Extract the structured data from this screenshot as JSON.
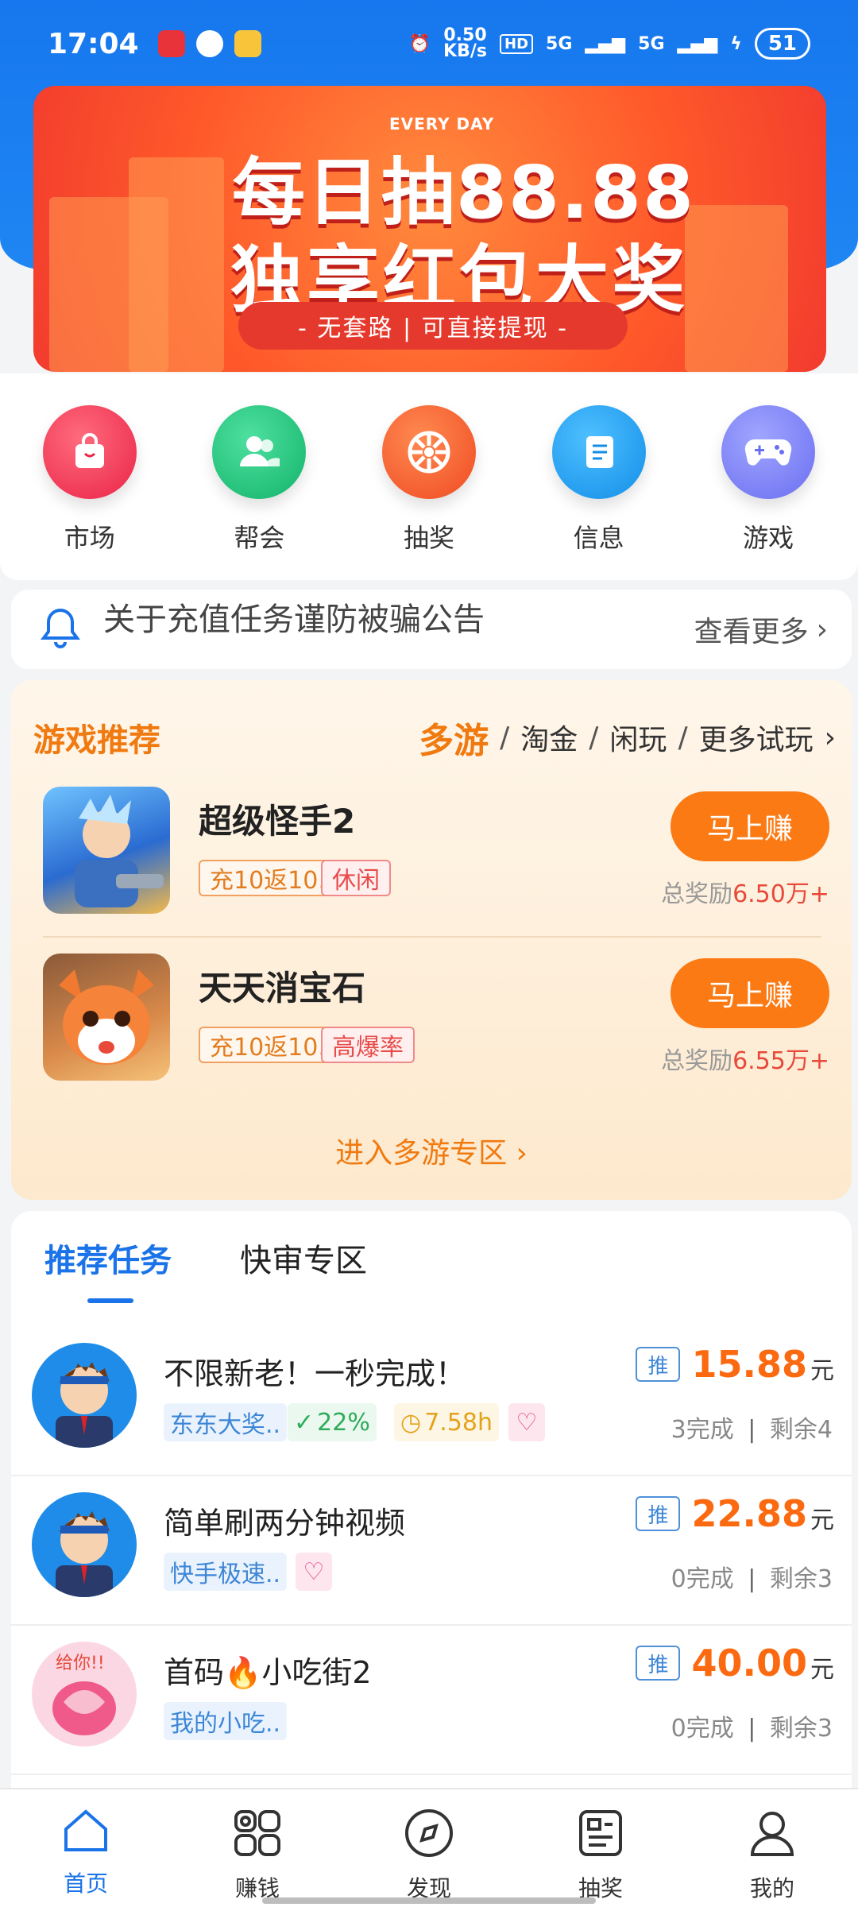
{
  "status_bar": {
    "time": "17:04",
    "net_speed": "0.50\nKB/s",
    "signal1": "5G",
    "signal2": "5G",
    "battery": "51"
  },
  "banner": {
    "tagline": "EVERY DAY",
    "line1": "每日抽88.88",
    "line2": "独享红包大奖",
    "pill": "- 无套路 | 可直接提现 -"
  },
  "quick_nav": [
    {
      "label": "市场",
      "icon": "bag-icon",
      "color": "#f23a55"
    },
    {
      "label": "帮会",
      "icon": "group-icon",
      "color": "#22c47e"
    },
    {
      "label": "抽奖",
      "icon": "wheel-icon",
      "color": "#f35a2c"
    },
    {
      "label": "信息",
      "icon": "document-icon",
      "color": "#1e9df3"
    },
    {
      "label": "游戏",
      "icon": "gamepad-icon",
      "color": "#7a7df5"
    }
  ],
  "notice": {
    "title": "关于充值任务谨防被骗公告",
    "more": "查看更多"
  },
  "games": {
    "title": "游戏推荐",
    "tabs": [
      "多游",
      "淘金",
      "闲玩",
      "更多试玩"
    ],
    "items": [
      {
        "name": "超级怪手2",
        "tag1": "充10返10.7元",
        "tag2": "休闲",
        "button": "马上赚",
        "reward_label": "总奖励",
        "reward_value": "6.50万+"
      },
      {
        "name": "天天消宝石",
        "tag1": "充10返10.7元",
        "tag2": "高爆率",
        "button": "马上赚",
        "reward_label": "总奖励",
        "reward_value": "6.55万+"
      }
    ],
    "enter": "进入多游专区"
  },
  "tasks": {
    "tabs": [
      "推荐任务",
      "快审专区"
    ],
    "items": [
      {
        "title": "不限新老！一秒完成！",
        "chip1": "东东大奖..",
        "chip2": "22%",
        "chip3": "7.58h",
        "badge": "推",
        "price": "15.88",
        "unit": "元",
        "done": "3完成",
        "left": "剩余4"
      },
      {
        "title": "简单刷两分钟视频",
        "chip1": "快手极速..",
        "badge": "推",
        "price": "22.88",
        "unit": "元",
        "done": "0完成",
        "left": "剩余3"
      },
      {
        "title": "首码🔥小吃街2",
        "chip1": "我的小吃..",
        "badge": "推",
        "price": "40.00",
        "unit": "元",
        "done": "0完成",
        "left": "剩余3"
      }
    ]
  },
  "bottom_nav": [
    {
      "label": "首页",
      "icon": "home-icon",
      "active": true
    },
    {
      "label": "赚钱",
      "icon": "grid-icon",
      "active": false
    },
    {
      "label": "发现",
      "icon": "compass-icon",
      "active": false
    },
    {
      "label": "抽奖",
      "icon": "lottery-icon",
      "active": false
    },
    {
      "label": "我的",
      "icon": "profile-icon",
      "active": false
    }
  ]
}
